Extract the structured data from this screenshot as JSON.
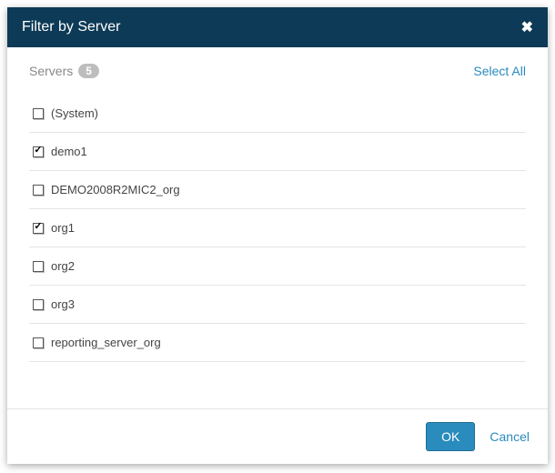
{
  "dialog": {
    "title": "Filter by Server",
    "servers_label": "Servers",
    "count": "5",
    "select_all": "Select All",
    "items": [
      {
        "label": "(System)",
        "checked": false
      },
      {
        "label": "demo1",
        "checked": true
      },
      {
        "label": "DEMO2008R2MIC2_org",
        "checked": false
      },
      {
        "label": "org1",
        "checked": true
      },
      {
        "label": "org2",
        "checked": false
      },
      {
        "label": "org3",
        "checked": false
      },
      {
        "label": "reporting_server_org",
        "checked": false
      }
    ],
    "ok": "OK",
    "cancel": "Cancel"
  }
}
